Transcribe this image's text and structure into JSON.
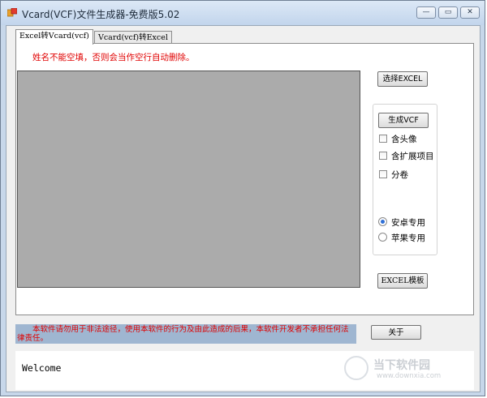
{
  "window": {
    "title": "Vcard(VCF)文件生成器-免费版5.02",
    "controls": {
      "minimize": "—",
      "maximize": "▭",
      "close": "✕"
    }
  },
  "tabs": [
    {
      "label": "Excel转Vcard(vcf)",
      "active": true
    },
    {
      "label": "Vcard(vcf)转Excel",
      "active": false
    }
  ],
  "panel": {
    "warning": "姓名不能空填，否则会当作空行自动删除。",
    "select_excel_button": "选择EXCEL",
    "generate_vcf_button": "生成VCF",
    "options": {
      "include_avatar": "含头像",
      "include_extended": "含扩展项目",
      "split_volumes": "分卷"
    },
    "platform": {
      "android": "安卓专用",
      "apple": "苹果专用",
      "selected": "android"
    },
    "excel_template_button": "EXCEL模板"
  },
  "footer": {
    "disclaimer": "　　本软件请勿用于非法途径，使用本软件的行为及由此造成的后果，本软件开发者不承担任何法律责任。",
    "about_button": "关于",
    "log_text": "Welcome"
  },
  "watermark": {
    "text": "当下软件园",
    "url": "www.downxia.com"
  },
  "colors": {
    "warning_red": "#e00000",
    "disclaimer_bg": "#9fb6d1",
    "grid_gray": "#ababab",
    "radio_accent": "#2f6fd6"
  }
}
